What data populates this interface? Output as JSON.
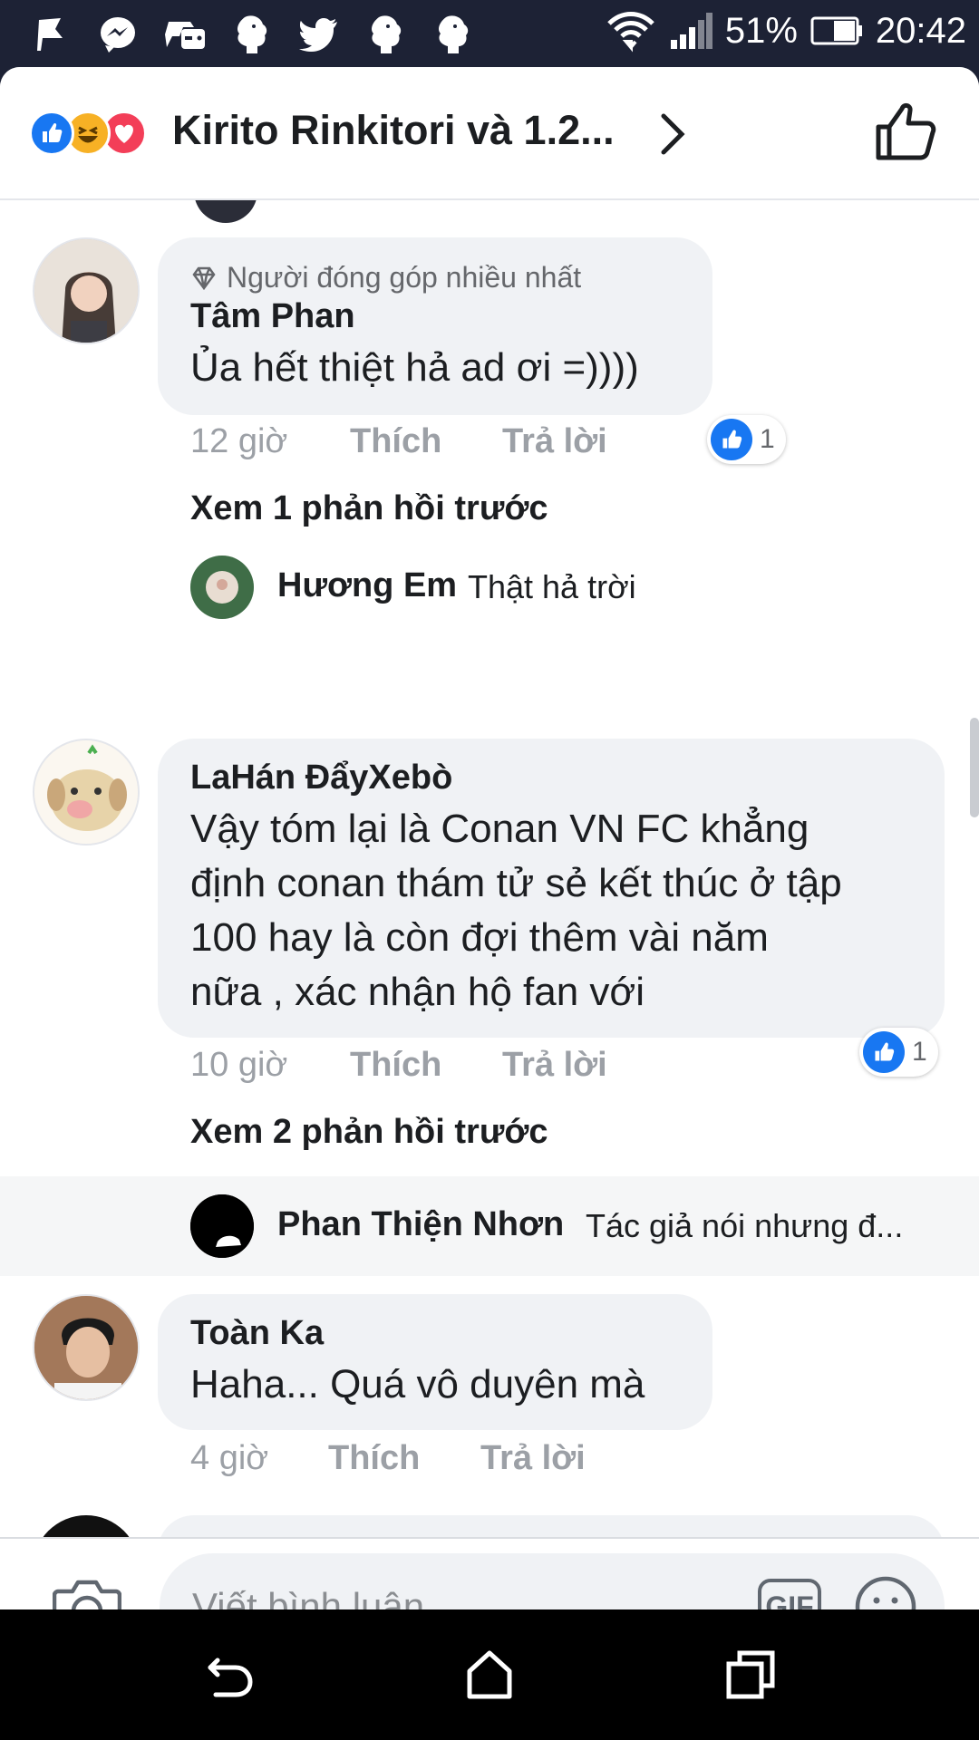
{
  "status_bar": {
    "battery_percent": "51%",
    "time": "20:42",
    "notification_icons": [
      "flag-icon",
      "messenger-icon",
      "game-controller-icon",
      "premier-league-icon",
      "twitter-icon",
      "premier-league-icon",
      "premier-league-icon"
    ]
  },
  "header": {
    "reactions": [
      "like",
      "haha",
      "love"
    ],
    "reactor_summary": "Kirito Rinkitori và 1.2..."
  },
  "comments": [
    {
      "badge": "Người đóng góp nhiều nhất",
      "author": "Tâm Phan",
      "text": "Ủa hết thiệt hả ad ơi =))))",
      "time": "12 giờ",
      "like_label": "Thích",
      "reply_label": "Trả lời",
      "like_count": "1",
      "view_previous": "Xem 1 phản hồi trước",
      "reply": {
        "author": "Hương Em",
        "text": "Thật hả trời"
      }
    },
    {
      "author": "LaHán ĐẩyXebò",
      "text_lines": [
        "Vậy tóm lại là Conan VN FC khẳng",
        "định conan  thám tử sẻ kết thúc ở tập",
        "100 hay là còn đợi thêm vài năm",
        "nữa , xác nhận hộ fan với"
      ],
      "time": "10 giờ",
      "like_label": "Thích",
      "reply_label": "Trả lời",
      "like_count": "1",
      "view_previous": "Xem 2 phản hồi trước",
      "reply": {
        "author": "Phan Thiện Nhơn",
        "text": "Tác giả nói nhưng đ..."
      }
    },
    {
      "author": "Toàn Ka",
      "text": "Haha... Quá vô duyên mà",
      "time": "4 giờ",
      "like_label": "Thích",
      "reply_label": "Trả lời"
    }
  ],
  "composer": {
    "placeholder": "Viết bình luận...",
    "gif_label": "GIF"
  },
  "colors": {
    "status_bar_bg": "#1d2235",
    "bubble_bg": "#f0f2f5",
    "like_blue": "#1877f2",
    "meta_gray": "#9ca0a6",
    "love_red": "#f33e58",
    "haha_yellow": "#f7b125"
  }
}
